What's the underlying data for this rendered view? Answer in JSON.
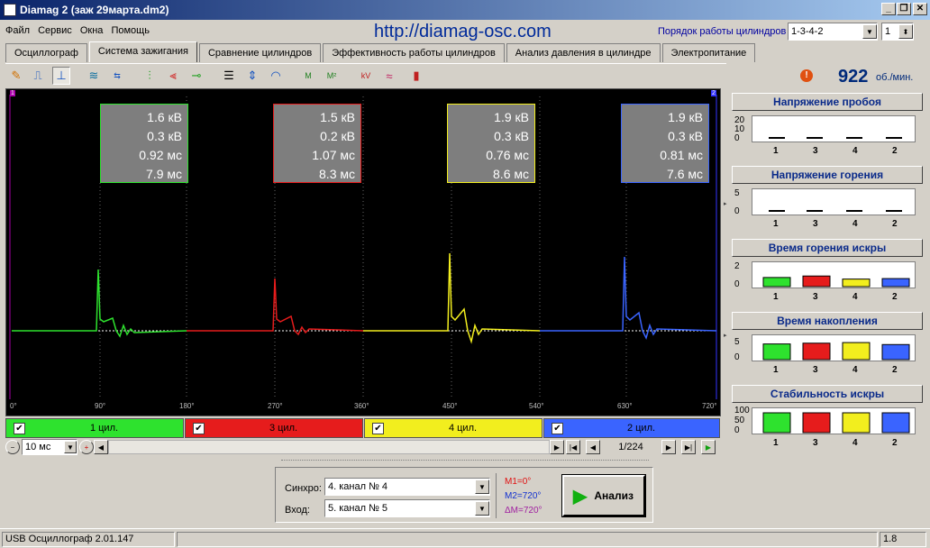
{
  "window": {
    "title": "Diamag 2 (заж 29марта.dm2)",
    "btn_min": "_",
    "btn_max": "❐",
    "btn_close": "✕"
  },
  "menu": [
    "Файл",
    "Сервис",
    "Окна",
    "Помощь"
  ],
  "header": {
    "url": "http://diamag-osc.com",
    "order_label": "Порядок работы цилиндров",
    "order_value": "1-3-4-2",
    "spin_value": "1"
  },
  "tabs": [
    "Осциллограф",
    "Система зажигания",
    "Сравнение цилиндров",
    "Эффективность работы цилиндров",
    "Анализ давления в цилиндре",
    "Электропитание"
  ],
  "active_tab": 1,
  "toolbar_icons": [
    "cursor-icon",
    "step-icon",
    "step-down-icon",
    "coil-icon",
    "order-icon",
    "wave-group-icon",
    "wave-up-icon",
    "wave-flat-icon",
    "lines-icon",
    "measure-icon",
    "timer-icon",
    "m-icon",
    "m2-icon",
    "kv-icon",
    "spectrum-icon",
    "bars-icon"
  ],
  "rpm": {
    "value": "922",
    "unit": "об./мин."
  },
  "cylinders": [
    {
      "kv1": "1.6 кВ",
      "kv2": "0.3 кВ",
      "t1": "0.92 мс",
      "t2": "7.9 мс",
      "color": "#2ee22e",
      "label": "1 цил.",
      "num": "1"
    },
    {
      "kv1": "1.5 кВ",
      "kv2": "0.2 кВ",
      "t1": "1.07 мс",
      "t2": "8.3 мс",
      "color": "#e61c1c",
      "label": "3 цил.",
      "num": "3"
    },
    {
      "kv1": "1.9 кВ",
      "kv2": "0.3 кВ",
      "t1": "0.76 мс",
      "t2": "8.6 мс",
      "color": "#f2ee1e",
      "label": "4 цил.",
      "num": "4"
    },
    {
      "kv1": "1.9 кВ",
      "kv2": "0.3 кВ",
      "t1": "0.81 мс",
      "t2": "7.6 мс",
      "color": "#3a64ff",
      "label": "2 цил.",
      "num": "2"
    }
  ],
  "x_axis": [
    "0°",
    "90°",
    "180°",
    "270°",
    "360°",
    "450°",
    "540°",
    "630°",
    "720°"
  ],
  "marker_left": "1",
  "marker_right": "2",
  "nav": {
    "time_scale": "10 мс",
    "page": "1/224"
  },
  "panels": [
    {
      "title": "Напряжение пробоя",
      "yticks": [
        "20",
        "10",
        "0"
      ]
    },
    {
      "title": "Напряжение горения",
      "yticks": [
        "5",
        "0"
      ]
    },
    {
      "title": "Время горения искры",
      "yticks": [
        "2",
        "0"
      ]
    },
    {
      "title": "Время накопления",
      "yticks": [
        "5",
        "0"
      ]
    },
    {
      "title": "Стабильность искры",
      "yticks": [
        "100",
        "50",
        "0"
      ]
    }
  ],
  "chart_data": [
    {
      "type": "bar",
      "title": "Время горения искры",
      "categories": [
        "1",
        "3",
        "4",
        "2"
      ],
      "values": [
        0.92,
        1.07,
        0.76,
        0.81
      ],
      "ylim": [
        0,
        2
      ]
    },
    {
      "type": "bar",
      "title": "Время накопления",
      "categories": [
        "1",
        "3",
        "4",
        "2"
      ],
      "values": [
        7.9,
        8.3,
        8.6,
        7.6
      ],
      "ylim": [
        0,
        10
      ]
    },
    {
      "type": "bar",
      "title": "Стабильность искры",
      "categories": [
        "1",
        "3",
        "4",
        "2"
      ],
      "values": [
        100,
        100,
        100,
        100
      ],
      "ylim": [
        0,
        100
      ]
    }
  ],
  "bottom": {
    "sync_label": "Синхро:",
    "sync_value": "4.   канал № 4",
    "input_label": "Вход:",
    "input_value": "5.   канал № 5",
    "m1": "M1=0°",
    "m2": "M2=720°",
    "dm": "ΔM=720°",
    "analyze": "Анализ"
  },
  "status": {
    "left": "USB Осциллограф  2.01.147",
    "right": "1.8"
  }
}
